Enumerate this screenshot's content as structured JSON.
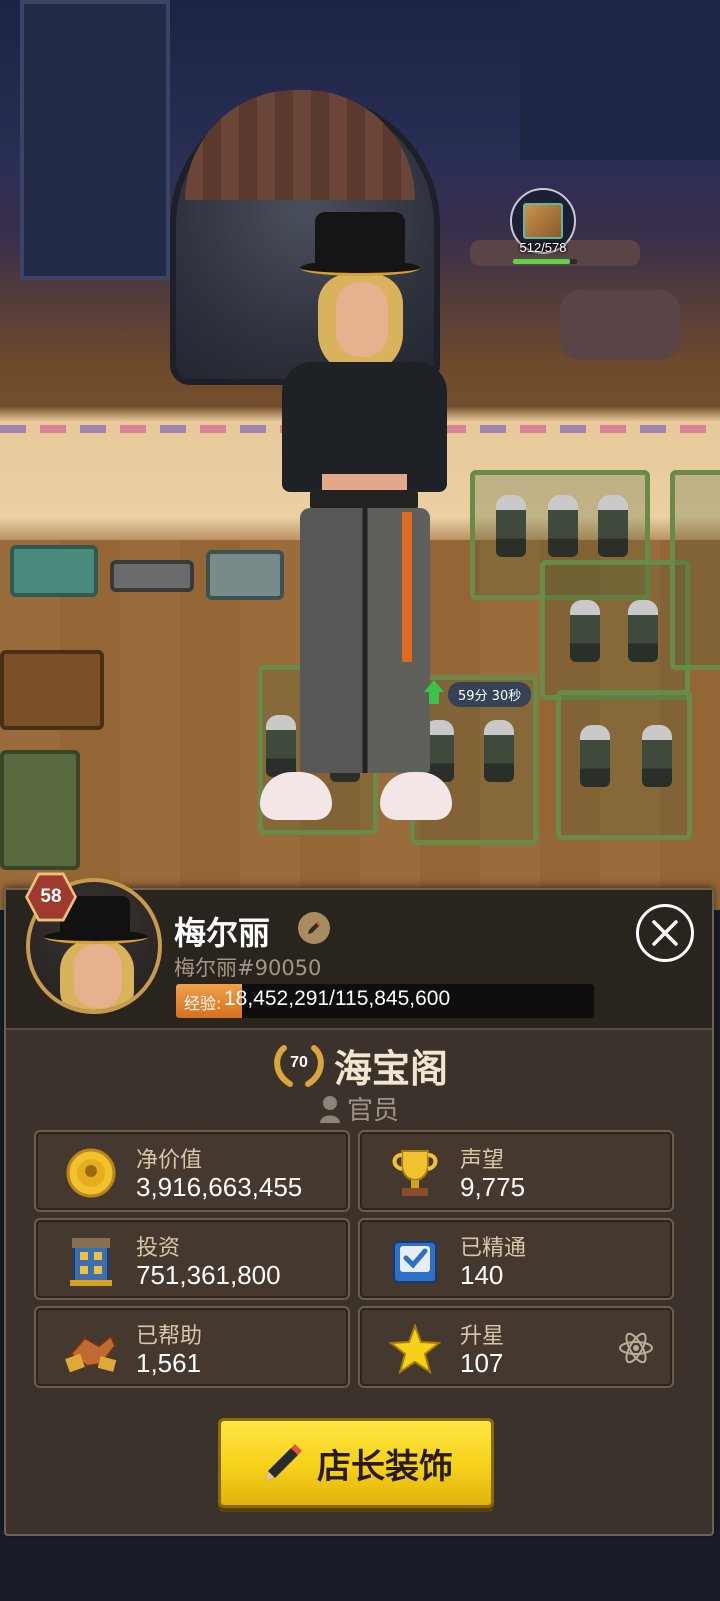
{
  "storage": {
    "label": "512/578",
    "fill": 0.886
  },
  "timer": {
    "text": "59分 30秒"
  },
  "profile": {
    "level": "58",
    "name": "梅尔丽",
    "id": "梅尔丽#90050",
    "xp_label": "经验:",
    "xp_value": "18,452,291/115,845,600",
    "xp_fraction": 0.159
  },
  "guild": {
    "level": "70",
    "name": "海宝阁",
    "rank": "官员"
  },
  "stats": [
    {
      "label": "净价值",
      "value": "3,916,663,455",
      "icon": "gold-coin-icon"
    },
    {
      "label": "声望",
      "value": "9,775",
      "icon": "trophy-icon"
    },
    {
      "label": "投资",
      "value": "751,361,800",
      "icon": "building-icon"
    },
    {
      "label": "已精通",
      "value": "140",
      "icon": "mastery-book-icon"
    },
    {
      "label": "已帮助",
      "value": "1,561",
      "icon": "handshake-icon"
    },
    {
      "label": "升星",
      "value": "107",
      "icon": "star-icon"
    }
  ],
  "decor_button": {
    "label": "店长装饰"
  },
  "colors": {
    "accent_yellow": "#f6d11a",
    "xp_orange": "#e07a24",
    "panel_bg": "#3b332b",
    "progress_green": "#5ed24a"
  }
}
